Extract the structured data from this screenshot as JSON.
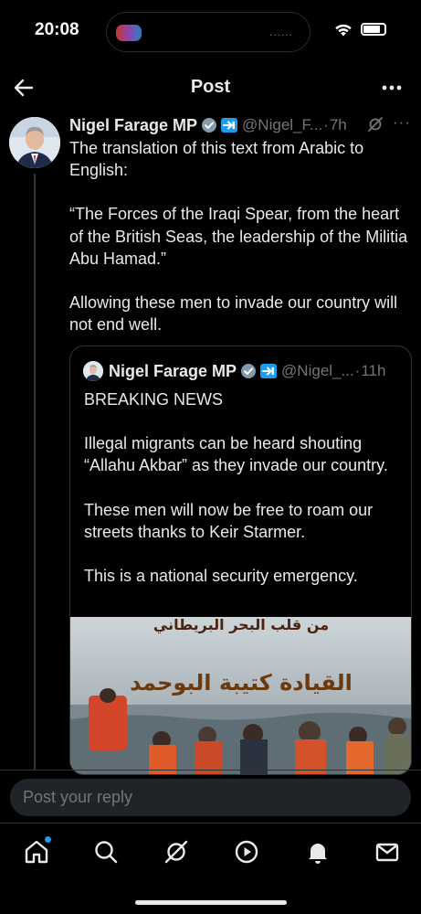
{
  "status_bar": {
    "time": "20:08",
    "island_dots": "......",
    "icons": [
      "wifi-icon",
      "battery-icon"
    ]
  },
  "header": {
    "title": "Post",
    "icons": [
      "back-arrow-icon",
      "more-horizontal-icon"
    ]
  },
  "post": {
    "author_name": "Nigel Farage MP",
    "handle": "@Nigel_F...",
    "separator": "·",
    "time": "7h",
    "more": "···",
    "paragraphs": [
      "The translation of this text from Arabic to English:",
      "“The Forces of the Iraqi Spear, from the heart of the British Seas, the leadership of the Militia Abu Hamad.”",
      "Allowing these men to invade our country will not end well."
    ]
  },
  "quote": {
    "author_name": "Nigel Farage MP",
    "handle": "@Nigel_...",
    "separator": "·",
    "time": "11h",
    "paragraphs": [
      "BREAKING NEWS",
      "Illegal migrants can be heard shouting “Allahu Akbar” as they invade our country.",
      "These men will now be free to roam our streets thanks to Keir Starmer.",
      "This is a national security emergency."
    ],
    "media_caption_top": "من قلب البحر البريطاني",
    "media_caption_main": "القيادة كتيبة البوحمد"
  },
  "reply": {
    "placeholder": "Post your reply"
  },
  "tabs": [
    {
      "name": "home",
      "icon": "home-icon",
      "active": true
    },
    {
      "name": "search",
      "icon": "search-icon"
    },
    {
      "name": "grok",
      "icon": "grok-icon"
    },
    {
      "name": "video",
      "icon": "play-icon"
    },
    {
      "name": "notifications",
      "icon": "bell-icon"
    },
    {
      "name": "messages",
      "icon": "mail-icon"
    }
  ],
  "colors": {
    "background": "#000000",
    "text": "#e7e9ea",
    "secondary_text": "#71767b",
    "accent": "#1d9bf0",
    "border": "#2f3336"
  }
}
